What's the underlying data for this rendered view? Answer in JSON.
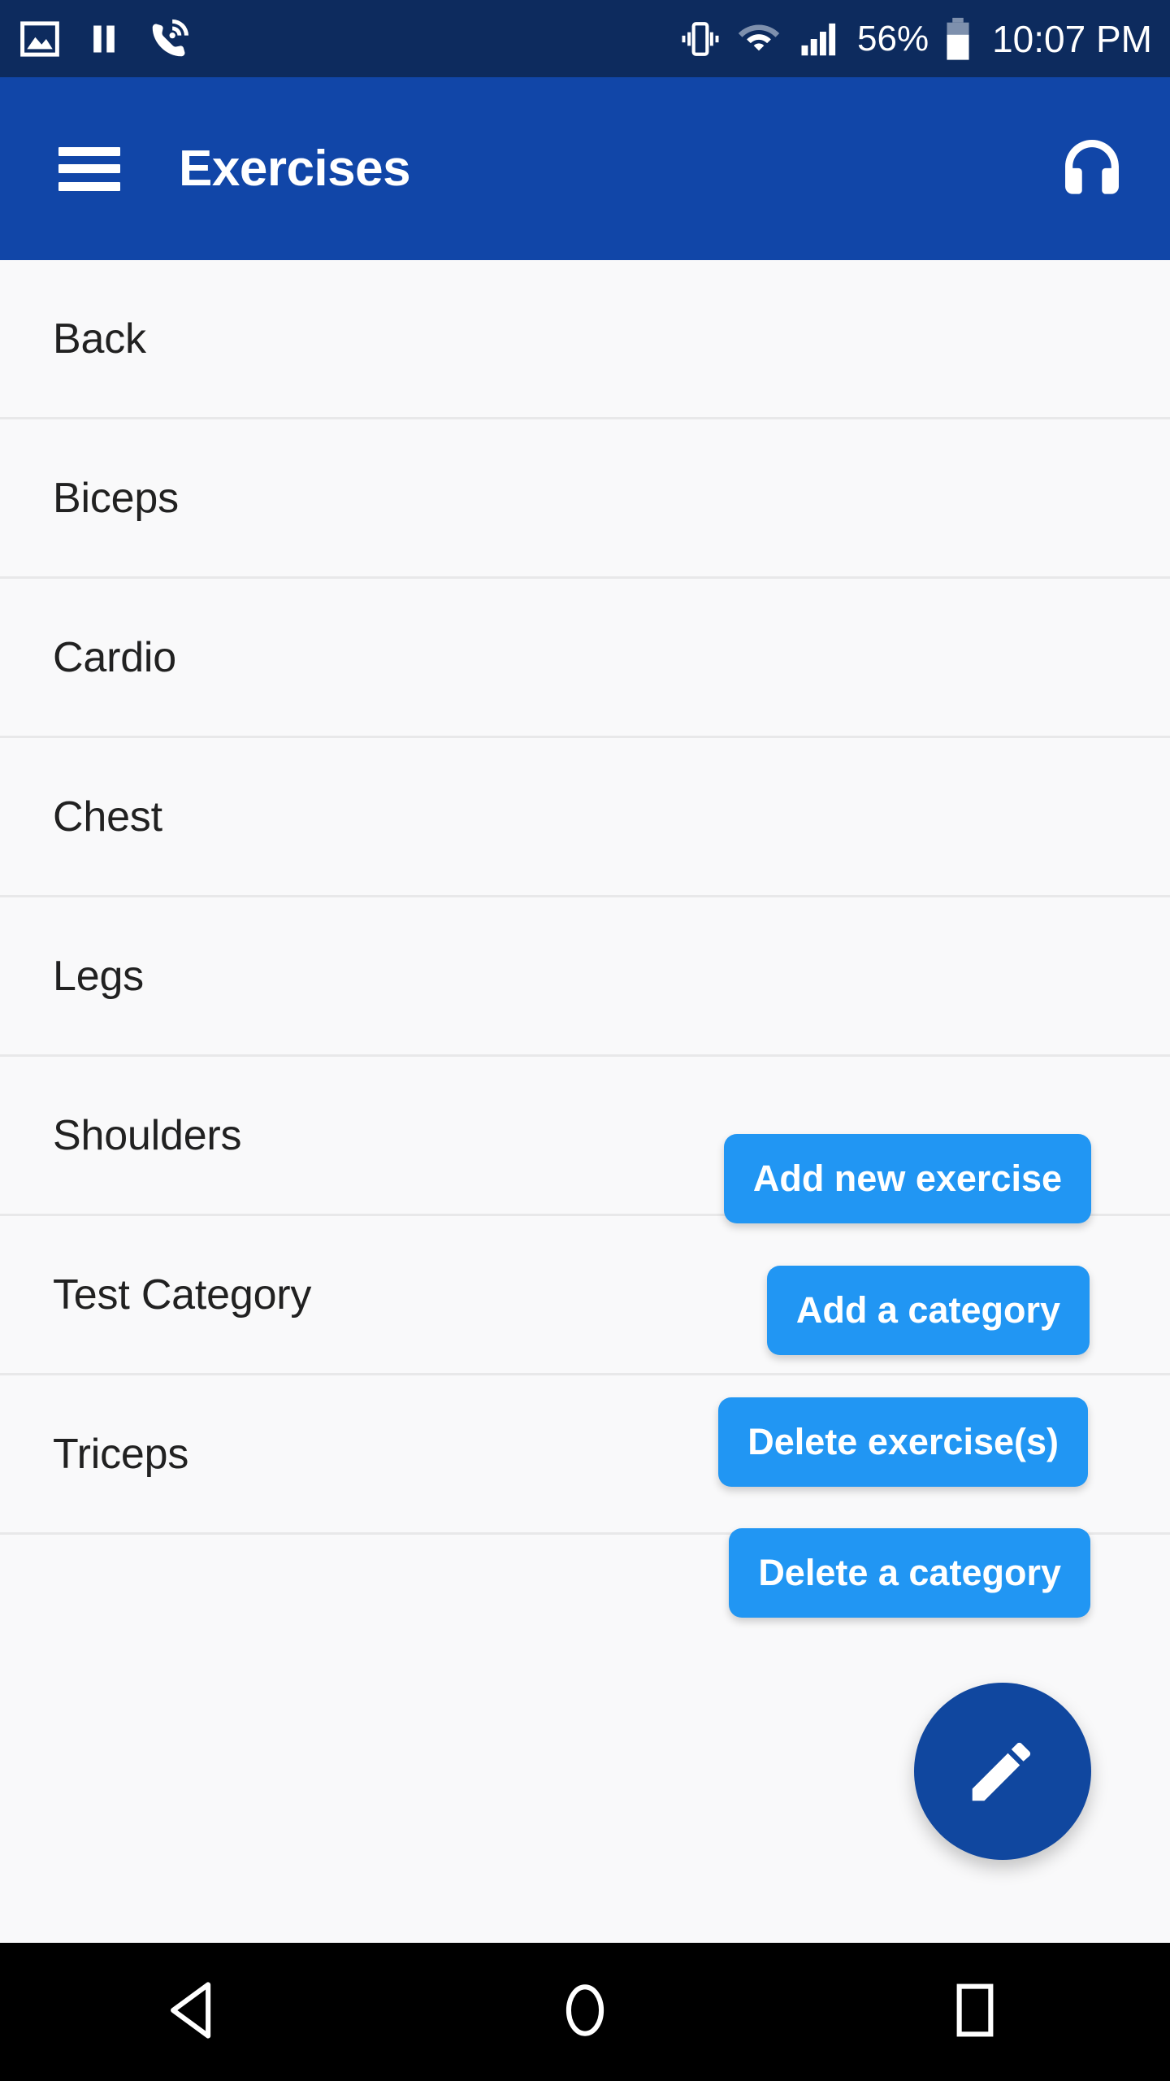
{
  "status_bar": {
    "left_icons": [
      "image-icon",
      "pause-icon",
      "call-wifi-icon"
    ],
    "right_icons": [
      "vibrate-icon",
      "wifi-icon",
      "signal-icon",
      "battery-icon"
    ],
    "battery_percent": "56%",
    "clock": "10:07 PM",
    "background_color": "#0d2b5e"
  },
  "app_bar": {
    "menu_icon": "hamburger-menu-icon",
    "title": "Exercises",
    "action_icon": "headphones-icon",
    "background_color": "#1146a8"
  },
  "list": {
    "items": [
      {
        "label": "Back"
      },
      {
        "label": "Biceps"
      },
      {
        "label": "Cardio"
      },
      {
        "label": "Chest"
      },
      {
        "label": "Legs"
      },
      {
        "label": "Shoulders"
      },
      {
        "label": "Test Category"
      },
      {
        "label": "Triceps"
      }
    ]
  },
  "action_buttons": [
    {
      "label": "Add new exercise"
    },
    {
      "label": "Add a category"
    },
    {
      "label": "Delete exercise(s)"
    },
    {
      "label": "Delete a category"
    }
  ],
  "fab": {
    "icon": "pencil-edit-icon",
    "color": "#10479f"
  },
  "nav_bar": {
    "back": "back-triangle-icon",
    "home": "home-circle-icon",
    "recents": "recents-square-icon",
    "background_color": "#000000"
  },
  "colors": {
    "accent_blue": "#2196f3",
    "app_bar_blue": "#1146a8",
    "status_bar_navy": "#0d2b5e",
    "list_background": "#f9f9fa",
    "divider": "#e8e8e9",
    "text_primary": "#212121"
  }
}
